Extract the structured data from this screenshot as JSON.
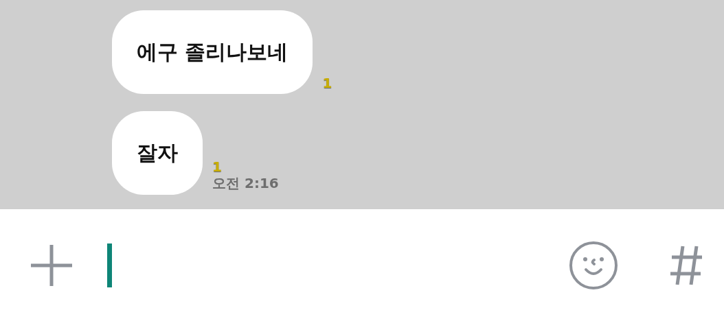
{
  "messages": [
    {
      "text": "에구 졸리나보네",
      "unread": "1"
    },
    {
      "text": "잘자",
      "unread": "1",
      "time": "오전 2:16"
    }
  ]
}
